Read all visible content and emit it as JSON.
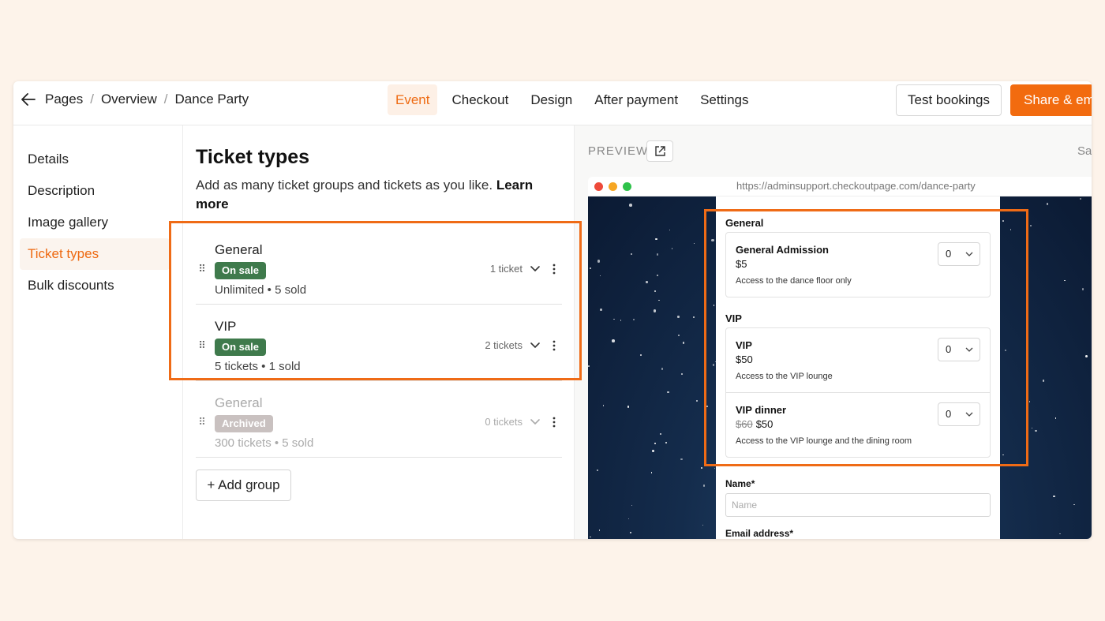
{
  "breadcrumb": {
    "items": [
      "Pages",
      "Overview",
      "Dance Party"
    ],
    "separator": "/"
  },
  "tabs": [
    {
      "label": "Event",
      "active": true
    },
    {
      "label": "Checkout",
      "active": false
    },
    {
      "label": "Design",
      "active": false
    },
    {
      "label": "After payment",
      "active": false
    },
    {
      "label": "Settings",
      "active": false
    }
  ],
  "actions": {
    "test_label": "Test bookings",
    "share_label": "Share & em"
  },
  "sidebar": {
    "items": [
      {
        "label": "Details",
        "active": false
      },
      {
        "label": "Description",
        "active": false
      },
      {
        "label": "Image gallery",
        "active": false
      },
      {
        "label": "Ticket types",
        "active": true
      },
      {
        "label": "Bulk discounts",
        "active": false
      }
    ]
  },
  "ticket_types": {
    "title": "Ticket types",
    "description": "Add as many ticket groups and tickets as you like.",
    "learn_more": "Learn more",
    "groups": [
      {
        "name": "General",
        "status": "On sale",
        "meta": "Unlimited • 5 sold",
        "count": "1 ticket",
        "archived": false
      },
      {
        "name": "VIP",
        "status": "On sale",
        "meta": "5 tickets • 1 sold",
        "count": "2 tickets",
        "archived": false
      },
      {
        "name": "General",
        "status": "Archived",
        "meta": "300 tickets • 5 sold",
        "count": "0 tickets",
        "archived": true
      }
    ],
    "add_group_label": "+ Add group"
  },
  "preview": {
    "label": "PREVIEW",
    "save_hint": "Sa",
    "url": "https://adminsupport.checkoutpage.com/dance-party",
    "sections": [
      {
        "heading": "General",
        "tickets": [
          {
            "name": "General Admission",
            "old_price": "",
            "price": "$5",
            "description": "Access to the dance floor only",
            "qty": "0"
          }
        ]
      },
      {
        "heading": "VIP",
        "tickets": [
          {
            "name": "VIP",
            "old_price": "",
            "price": "$50",
            "description": "Access to the VIP lounge",
            "qty": "0"
          },
          {
            "name": "VIP dinner",
            "old_price": "$60",
            "price": "$50",
            "description": "Access to the VIP lounge and the dining room",
            "qty": "0"
          }
        ]
      }
    ],
    "fields": [
      {
        "label": "Name",
        "required": "*",
        "placeholder": "Name"
      },
      {
        "label": "Email address",
        "required": "*",
        "placeholder": ""
      }
    ]
  },
  "colors": {
    "accent": "#f26b0f",
    "on_sale": "#3f7a4c",
    "archived": "#c9c1c0",
    "highlight": "#ef6b16"
  }
}
